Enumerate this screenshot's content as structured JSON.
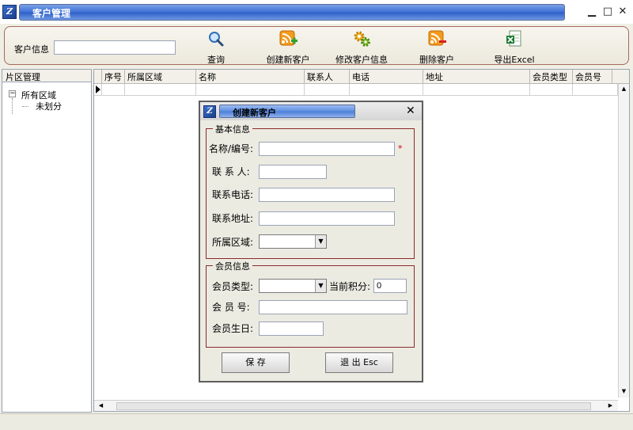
{
  "window": {
    "title": "客户管理",
    "minimize": "▁",
    "maximize": "□",
    "close": "✕"
  },
  "toolbar": {
    "customer_label": "客户信息",
    "customer_value": "",
    "buttons": [
      {
        "label": "查询",
        "icon": "search-icon"
      },
      {
        "label": "创建新客户",
        "icon": "rss-add-icon"
      },
      {
        "label": "修改客户信息",
        "icon": "gears-icon"
      },
      {
        "label": "删除客户",
        "icon": "rss-remove-icon"
      },
      {
        "label": "导出Excel",
        "icon": "excel-icon"
      }
    ]
  },
  "left_panel": {
    "header": "片区管理",
    "tree_root": "所有区域",
    "tree_child": "未划分",
    "expander": "−"
  },
  "grid": {
    "columns": [
      "序号",
      "所属区域",
      "名称",
      "联系人",
      "电话",
      "地址",
      "会员类型",
      "会员号"
    ]
  },
  "dialog": {
    "title": "创建新客户",
    "close": "✕",
    "basic_group": "基本信息",
    "name_label": "名称/编号:",
    "required_mark": "*",
    "contact_label": "联 系 人:",
    "phone_label": "联系电话:",
    "address_label": "联系地址:",
    "region_label": "所属区域:",
    "member_group": "会员信息",
    "member_type_label": "会员类型:",
    "points_label": "当前积分:",
    "points_value": "0",
    "member_no_label": "会 员 号:",
    "birthday_label": "会员生日:",
    "save_label": "保 存",
    "exit_label": "退 出 Esc"
  },
  "colors": {
    "title_blue": "#3d6fd4",
    "toolbar_border": "#a56a5c",
    "group_border": "#8c2a2a",
    "required_red": "#d00000"
  }
}
